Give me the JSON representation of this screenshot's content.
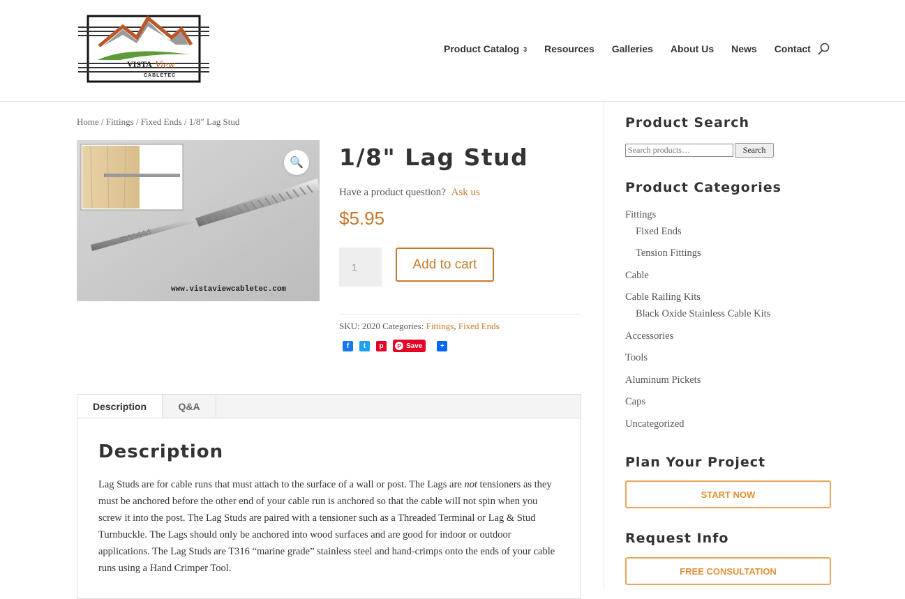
{
  "logo": {
    "brand": "VISTA",
    "brand_accent": "View",
    "sub": "CABLETEC"
  },
  "nav": {
    "items": [
      {
        "label": "Product Catalog",
        "caret": "3"
      },
      {
        "label": "Resources"
      },
      {
        "label": "Galleries"
      },
      {
        "label": "About Us"
      },
      {
        "label": "News"
      },
      {
        "label": "Contact"
      }
    ],
    "search_icon": "search-icon"
  },
  "breadcrumb": {
    "home": "Home",
    "sep": "/",
    "cat1": "Fittings",
    "cat2": "Fixed Ends",
    "current": "1/8″ Lag Stud"
  },
  "product": {
    "title": "1/8\" Lag Stud",
    "question_text": "Have a product question?",
    "ask_link": "Ask us",
    "price": "$5.95",
    "qty": "1",
    "add_to_cart": "Add to cart",
    "image_watermark": "www.vistaviewcabletec.com",
    "sku_label": "SKU:",
    "sku": "2020",
    "categories_label": "Categories:",
    "categories": [
      "Fittings",
      "Fixed Ends"
    ],
    "save_label": "Save"
  },
  "tabs": {
    "description": "Description",
    "qa": "Q&A"
  },
  "description": {
    "heading": "Description",
    "p_before_em": "Lag Studs are for cable runs that must attach to the surface of a wall or post. The Lags are ",
    "p_em": "not",
    "p_after_em": " tensioners as they must be anchored before the other end of your cable run is anchored so that the cable will not spin when you screw it into the post. The Lag Studs are paired with a tensioner such as a Threaded Terminal or Lag & Stud Turnbuckle. The Lags should only be anchored into wood surfaces and are good for indoor or outdoor applications. The Lag Studs are T316 “marine grade” stainless steel and hand-crimps onto the ends of your cable runs using a Hand Crimper Tool."
  },
  "sidebar": {
    "search_heading": "Product Search",
    "search_placeholder": "Search products…",
    "search_button": "Search",
    "categories_heading": "Product Categories",
    "categories": [
      {
        "label": "Fittings",
        "level": 0
      },
      {
        "label": "Fixed Ends",
        "level": 1
      },
      {
        "label": "Tension Fittings",
        "level": 1
      },
      {
        "label": "Cable",
        "level": 0
      },
      {
        "label": "Cable Railing Kits",
        "level": 0
      },
      {
        "label": "Black Oxide Stainless Cable Kits",
        "level": 1
      },
      {
        "label": "Accessories",
        "level": 0
      },
      {
        "label": "Tools",
        "level": 0
      },
      {
        "label": "Aluminum Pickets",
        "level": 0
      },
      {
        "label": "Caps",
        "level": 0
      },
      {
        "label": "Uncategorized",
        "level": 0
      }
    ],
    "plan_heading": "Plan Your Project",
    "plan_button": "START NOW",
    "request_heading": "Request Info",
    "request_button": "FREE CONSULTATION"
  },
  "colors": {
    "accent": "#c47a2c",
    "button_border": "#e8a75c",
    "pinterest": "#e60023",
    "facebook": "#1877f2",
    "twitter": "#1da1f2"
  }
}
